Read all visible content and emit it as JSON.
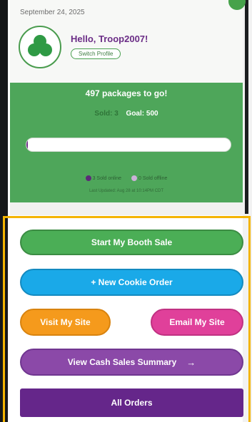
{
  "header": {
    "date": "September 24, 2025",
    "greeting": "Hello, Troop2007!",
    "switch_profile_label": "Switch Profile"
  },
  "progress": {
    "remaining_text": "497 packages to go!",
    "sold_label": "Sold: 3",
    "goal_label": "Goal: 500",
    "sold": 3,
    "goal": 500,
    "legend_online": "3 Sold online",
    "legend_offline": "0 Sold offline",
    "last_updated": "Last Updated: Aug 28 at 10:14PM CDT"
  },
  "actions": {
    "booth_sale": "Start My Booth Sale",
    "new_order": "+ New Cookie Order",
    "visit_site": "Visit My Site",
    "email_site": "Email My Site",
    "cash_summary": "View Cash Sales Summary",
    "cash_arrow": "→",
    "all_orders": "All Orders"
  },
  "colors": {
    "brand_green": "#4ea65a",
    "brand_purple": "#6b2d86",
    "highlight": "#f4b400"
  },
  "icons": {
    "logo": "trefoil-logo",
    "arrow": "arrow-right-icon"
  }
}
